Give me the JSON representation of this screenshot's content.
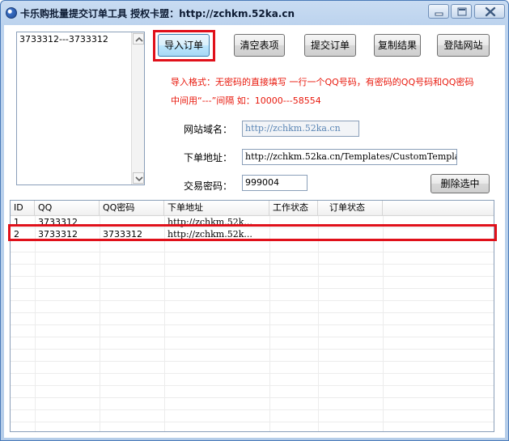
{
  "window": {
    "title": "卡乐购批量提交订单工具 授权卡盟：http://zchkm.52ka.cn",
    "app_icon": "app-logo-icon",
    "caption_buttons": [
      "minimize-icon",
      "maximize-icon",
      "close-icon"
    ]
  },
  "import_text": "3733312---3733312",
  "toolbar": {
    "import_label": "导入订单",
    "clear_label": "清空表项",
    "submit_label": "提交订单",
    "copy_label": "复制结果",
    "login_label": "登陆网站"
  },
  "hint": {
    "line1": "导入格式：无密码的直接填写 一行一个QQ号码，有密码的QQ号码和QQ密码",
    "line2": "中间用“---”间隔 如：10000---58554"
  },
  "form": {
    "domain_label": "网站域名：",
    "domain_value": "http://zchkm.52ka.cn",
    "order_url_label": "下单地址：",
    "order_url_value": "http://zchkm.52ka.cn/Templates/CustomTemplat",
    "trade_pwd_label": "交易密码：",
    "trade_pwd_value": "999004",
    "delete_label": "删除选中"
  },
  "table": {
    "columns": [
      "ID",
      "QQ",
      "QQ密码",
      "下单地址",
      "工作状态",
      "订单状态"
    ],
    "rows": [
      {
        "id": "1",
        "qq": "3733312",
        "pwd": "",
        "url": "http://zchkm.52k...",
        "work": "",
        "order": ""
      },
      {
        "id": "2",
        "qq": "3733312",
        "pwd": "3733312",
        "url": "http://zchkm.52k...",
        "work": "",
        "order": ""
      }
    ]
  },
  "colors": {
    "highlight": "#e0101a",
    "hint_text": "#e8180c",
    "title_bar": "#bcd3ee"
  }
}
